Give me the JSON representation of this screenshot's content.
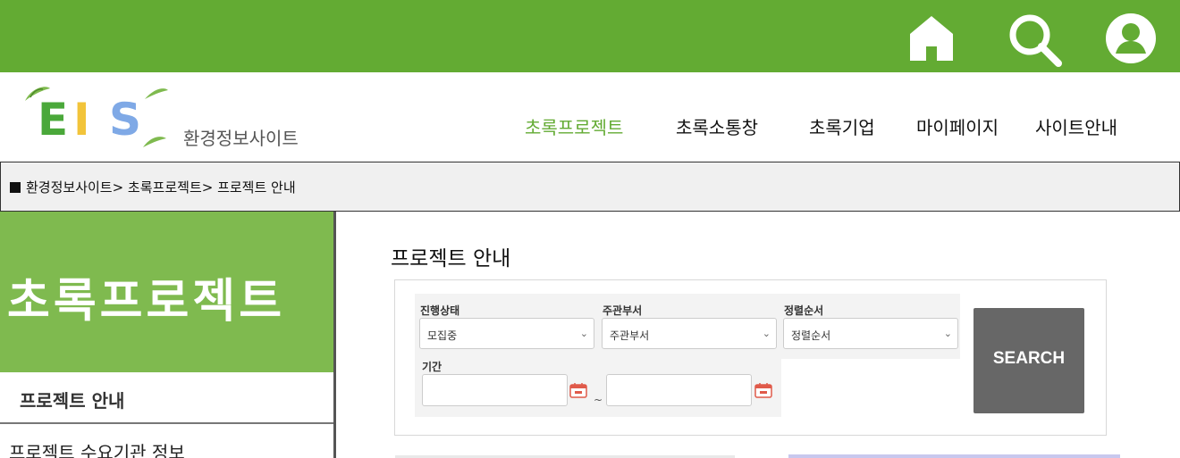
{
  "colors": {
    "brand_green": "#63ab33",
    "panel_green": "#7fba4f",
    "search_button": "#676767"
  },
  "topbar": {
    "icons": [
      "home-icon",
      "search-icon",
      "user-icon"
    ]
  },
  "header": {
    "logo_text": "EIS",
    "site_name": "환경정보사이트",
    "nav": [
      {
        "label": "초록프로젝트",
        "active": true
      },
      {
        "label": "초록소통창"
      },
      {
        "label": "초록기업"
      },
      {
        "label": "마이페이지"
      },
      {
        "label": "사이트안내"
      }
    ]
  },
  "breadcrumb": {
    "text": "환경정보사이트> 초록프로젝트> 프로젝트 안내"
  },
  "sidebar": {
    "title": "초록프로젝트",
    "items": [
      {
        "label": "프로젝트 안내"
      },
      {
        "label": "프로젝트 수요기관 정보"
      }
    ]
  },
  "main": {
    "title": "프로젝트 안내",
    "filters": {
      "status": {
        "label": "진행상태",
        "value": "모집중"
      },
      "department": {
        "label": "주관부서",
        "value": "주관부서"
      },
      "sort": {
        "label": "정렬순서",
        "value": "정렬순서"
      },
      "period": {
        "label": "기간",
        "separator": "~"
      }
    },
    "search_label": "SEARCH"
  }
}
